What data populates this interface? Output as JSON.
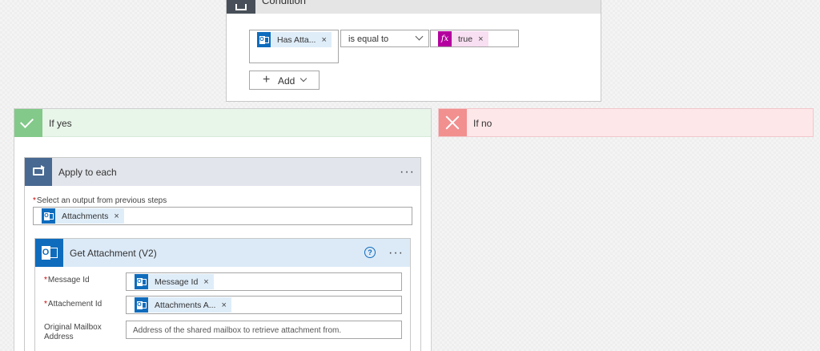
{
  "condition": {
    "title": "Condition",
    "left_token": {
      "icon": "outlook-icon",
      "label": "Has Atta...",
      "close": "×"
    },
    "operator": "is equal to",
    "right_token": {
      "icon": "fx-icon",
      "icon_text": "fx",
      "label": "true",
      "close": "×"
    },
    "add_button": {
      "plus": "+",
      "label": "Add"
    }
  },
  "branches": {
    "yes": {
      "label": "If yes",
      "color": "#82c98a"
    },
    "no": {
      "label": "If no",
      "color": "#f1908f"
    }
  },
  "apply_to_each": {
    "title": "Apply to each",
    "menu": "···",
    "field": {
      "required_mark": "*",
      "label": "Select an output from previous steps",
      "token": {
        "label": "Attachments",
        "close": "×"
      }
    }
  },
  "get_attachment": {
    "title": "Get Attachment (V2)",
    "help": "?",
    "menu": "···",
    "icon_letter": "O",
    "fields": [
      {
        "required_mark": "*",
        "label": "Message Id",
        "token_label": "Message Id",
        "close": "×"
      },
      {
        "required_mark": "*",
        "label": "Attachement Id",
        "token_label": "Attachments A...",
        "close": "×"
      },
      {
        "label_line1": "Original Mailbox",
        "label_line2": "Address",
        "placeholder": "Address of the shared mailbox to retrieve attachment from."
      }
    ]
  },
  "colors": {
    "outlook_blue": "#0f6cbd",
    "fx_magenta": "#b4009e",
    "loop_blue": "#486991"
  }
}
